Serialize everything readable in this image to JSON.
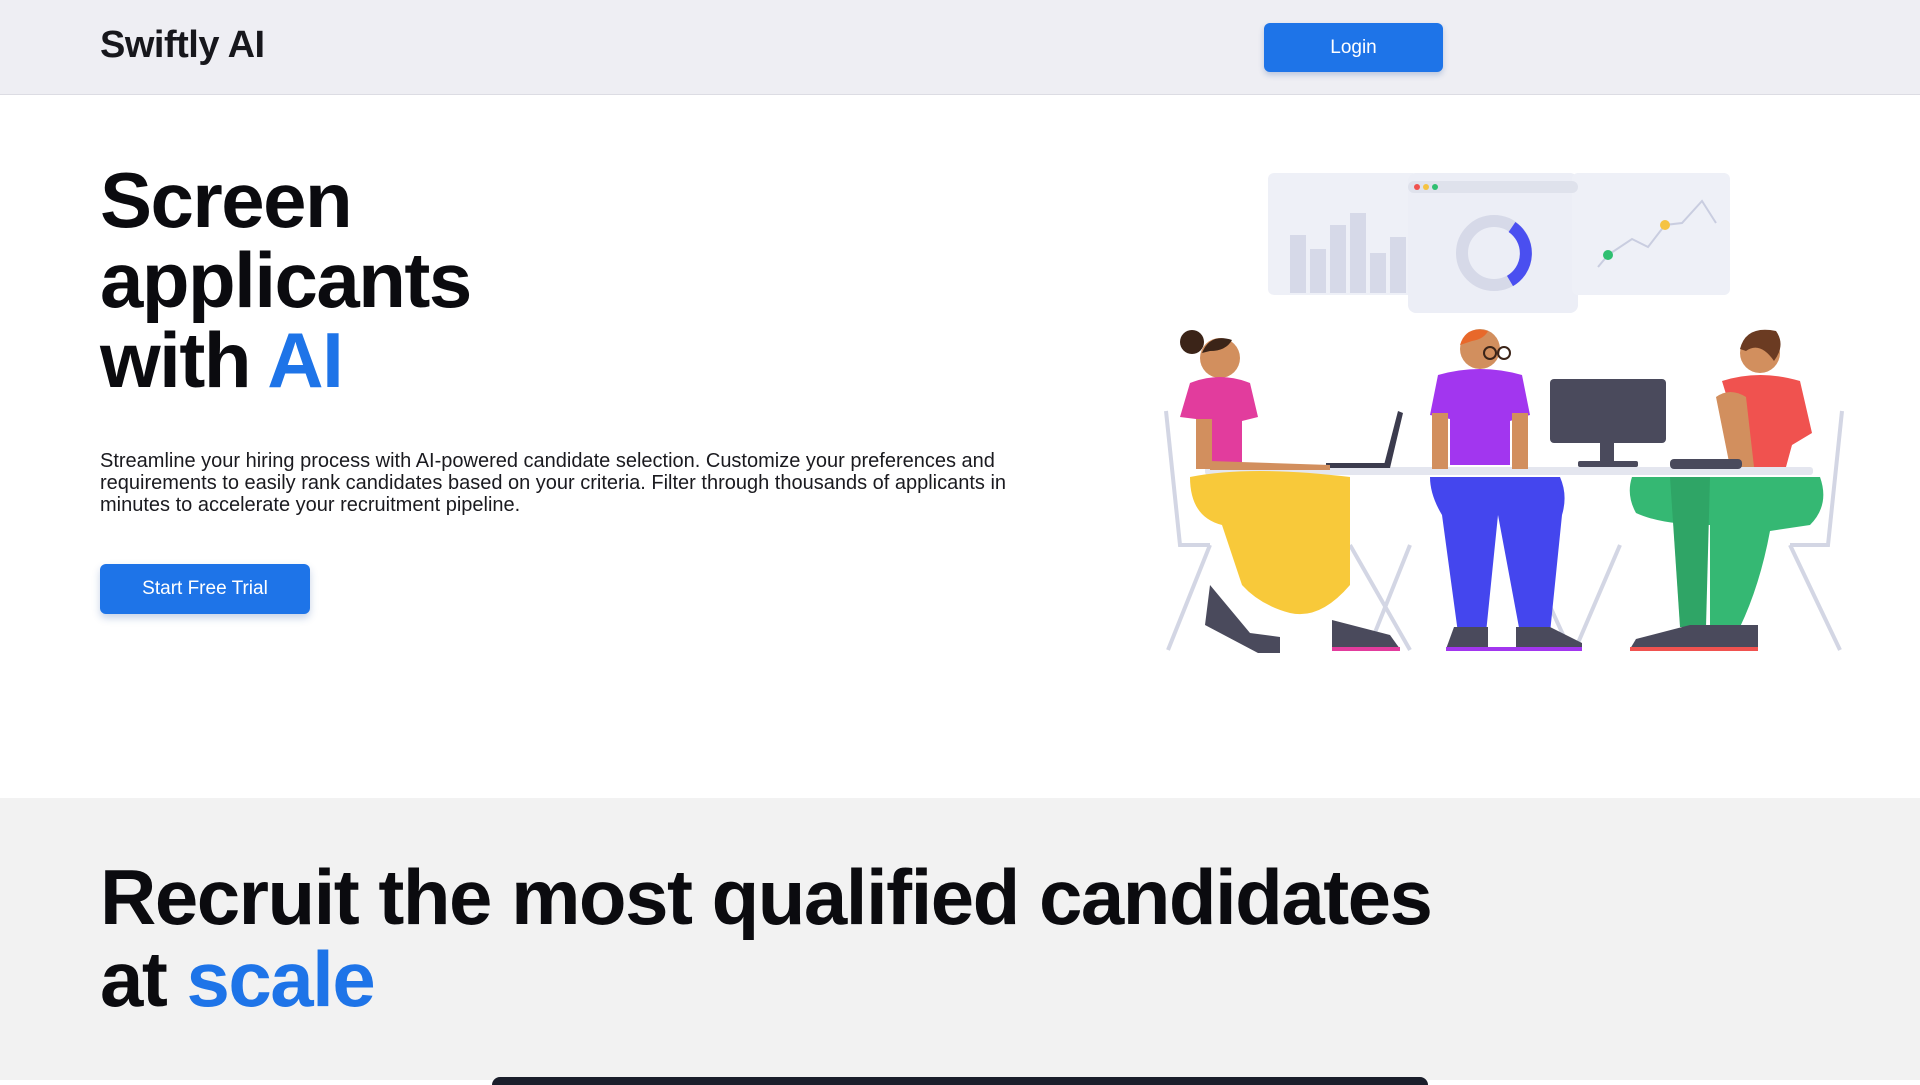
{
  "header": {
    "brand": "Swiftly AI",
    "login_label": "Login"
  },
  "hero": {
    "title_line1": "Screen",
    "title_line2": "applicants",
    "title_line3_prefix": "with ",
    "title_line3_accent": "AI",
    "description": "Streamline your hiring process with AI-powered candidate selection. Customize your preferences and requirements to easily rank candidates based on your criteria. Filter through thousands of applicants in minutes to accelerate your recruitment pipeline.",
    "cta_label": "Start Free Trial"
  },
  "section2": {
    "title_line1": "Recruit the most qualified candidates",
    "title_line2_prefix": "at ",
    "title_line2_accent": "scale"
  },
  "colors": {
    "accent": "#1e74e8",
    "nav_bg": "#eeeef3",
    "section_bg": "#f2f2f2"
  },
  "illustration": {
    "subject": "three people working at a shared desk with laptop and monitor under analytics dashboard",
    "icons": [
      "bar-chart-icon",
      "donut-chart-icon",
      "line-chart-icon",
      "monitor-icon",
      "laptop-icon"
    ]
  }
}
